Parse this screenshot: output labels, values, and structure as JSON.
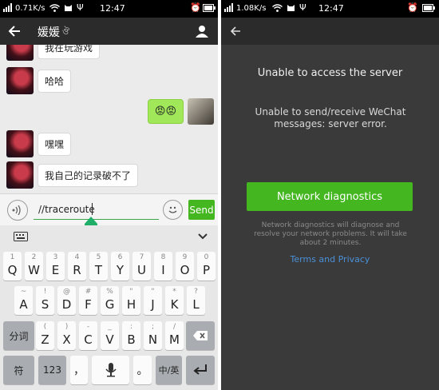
{
  "left": {
    "status": {
      "speed": "0.71K/s",
      "time": "12:47"
    },
    "header": {
      "title": "媛媛"
    },
    "messages": [
      {
        "text": "我在玩游戏",
        "side": "left"
      },
      {
        "text": "哈哈",
        "side": "left"
      },
      {
        "text": "😡😡",
        "side": "right"
      },
      {
        "text": "嘿嘿",
        "side": "left"
      },
      {
        "text": "我自己的记录破不了",
        "side": "left"
      }
    ],
    "input": {
      "value": "//traceroute",
      "send_label": "Send"
    },
    "keyboard": {
      "row1": [
        {
          "k": "Q",
          "s": "1"
        },
        {
          "k": "W",
          "s": "2"
        },
        {
          "k": "E",
          "s": "3"
        },
        {
          "k": "R",
          "s": "4"
        },
        {
          "k": "T",
          "s": "5"
        },
        {
          "k": "Y",
          "s": "6"
        },
        {
          "k": "U",
          "s": "7"
        },
        {
          "k": "I",
          "s": "8"
        },
        {
          "k": "O",
          "s": "9"
        },
        {
          "k": "P",
          "s": "0"
        }
      ],
      "row2": [
        {
          "k": "A",
          "s": "~"
        },
        {
          "k": "S",
          "s": "!"
        },
        {
          "k": "D",
          "s": "@"
        },
        {
          "k": "F",
          "s": "#"
        },
        {
          "k": "G",
          "s": "%"
        },
        {
          "k": "H",
          "s": "\""
        },
        {
          "k": "J",
          "s": "\""
        },
        {
          "k": "K",
          "s": "*"
        },
        {
          "k": "L",
          "s": "?"
        }
      ],
      "row3": [
        {
          "k": "Z",
          "s": "("
        },
        {
          "k": "X",
          "s": ")"
        },
        {
          "k": "C",
          "s": "-"
        },
        {
          "k": "V",
          "s": "_"
        },
        {
          "k": "B",
          "s": ":"
        },
        {
          "k": "N",
          "s": ";"
        },
        {
          "k": "M",
          "s": "/"
        }
      ],
      "fenci": "分词",
      "fu": "符",
      "num": "123",
      "comma": "，",
      "period": "。",
      "lang": "中/英"
    }
  },
  "right": {
    "status": {
      "speed": "1.08K/s",
      "time": "12:47"
    },
    "title": "Unable to access the server",
    "description": "Unable to send/receive WeChat messages: server error.",
    "button_label": "Network diagnostics",
    "note": "Network diagnostics will diagnose and resolve your network problems. It will take about 2 minutes.",
    "terms_link": "Terms and Privacy"
  },
  "colors": {
    "green": "#44b720",
    "link": "#4a90d9",
    "bubble_green": "#a0e75a"
  },
  "icons": [
    "back-arrow-icon",
    "person-icon",
    "voice-icon",
    "emoji-icon",
    "keyboard-icon",
    "chevron-down-icon",
    "microphone-icon",
    "backspace-icon",
    "enter-icon",
    "signal-icon",
    "wifi-icon",
    "usb-icon",
    "alarm-icon",
    "battery-icon",
    "cat-icon"
  ]
}
